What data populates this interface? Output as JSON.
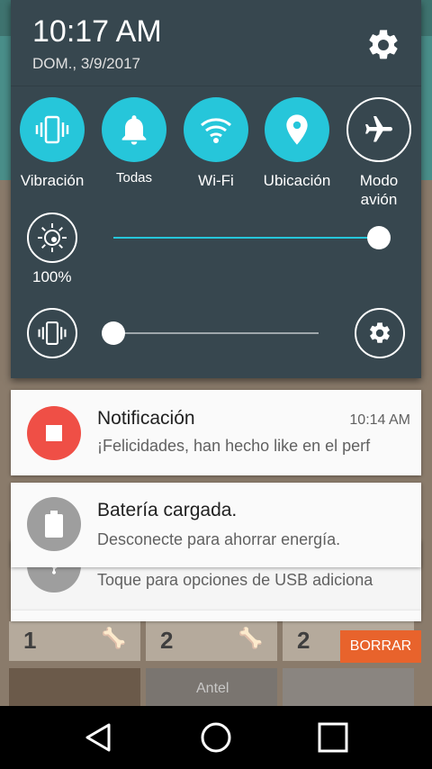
{
  "status": {
    "time": "10:17 AM",
    "date": "DOM., 3/9/2017"
  },
  "quick_settings": {
    "tiles": [
      {
        "label": "Vibración",
        "icon": "vibrate-icon",
        "active": true
      },
      {
        "label": "Todas",
        "icon": "bell-icon",
        "active": true
      },
      {
        "label": "Wi-Fi",
        "icon": "wifi-icon",
        "active": true
      },
      {
        "label": "Ubicación",
        "icon": "location-pin-icon",
        "active": true
      },
      {
        "label": "Modo\navión",
        "icon": "airplane-icon",
        "active": false
      }
    ],
    "brightness": {
      "percent_label": "100%",
      "value": 1.0
    },
    "volume": {
      "value": 0.0
    },
    "accent_color": "#26c6da"
  },
  "notifications": [
    {
      "title": "Notificación",
      "time": "10:14 AM",
      "text": "¡Felicidades, han hecho like en el perf",
      "icon": "stop-icon",
      "icon_color": "#ef4f46"
    },
    {
      "title": "Batería cargada.",
      "text": "Desconecte para ahorrar energía.",
      "icon": "battery-icon",
      "icon_color": "#9e9e9e"
    },
    {
      "text": "Toque para opciones de USB adiciona",
      "icon": "usb-icon"
    }
  ],
  "clear_button": {
    "label": "BORRAR",
    "color": "#e8632c"
  },
  "background_app": {
    "cells": [
      "1",
      "2",
      "2"
    ],
    "caption": "Antel"
  },
  "navbar": {
    "back": "back-icon",
    "home": "home-icon",
    "recents": "recents-icon"
  }
}
